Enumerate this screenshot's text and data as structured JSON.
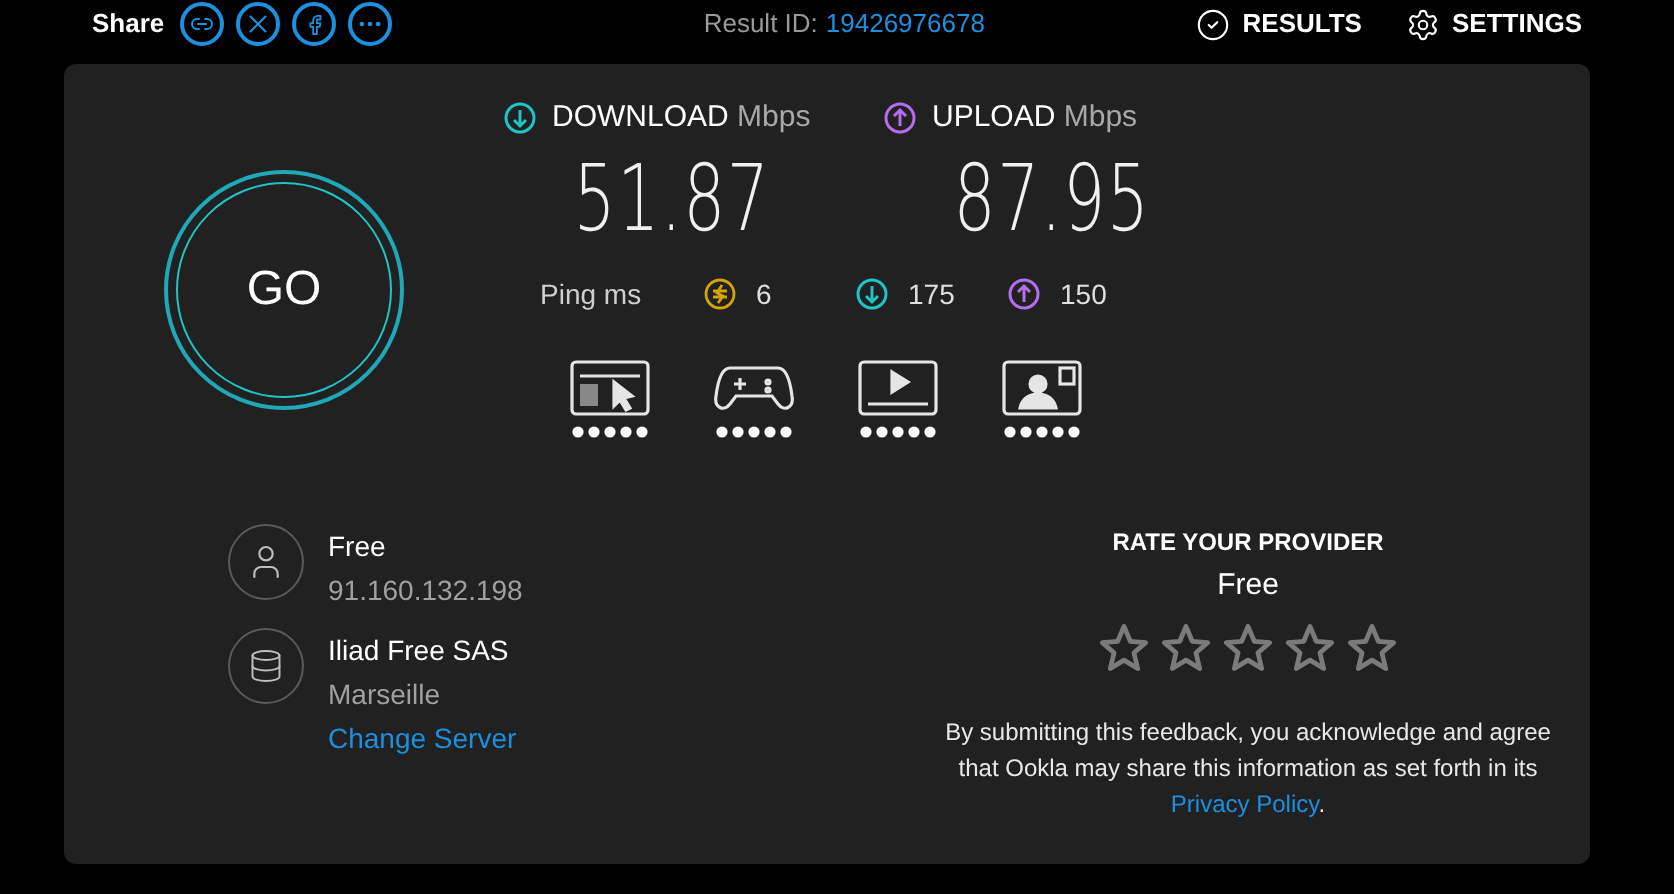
{
  "header": {
    "share_label": "Share",
    "result_label": "Result ID:",
    "result_id": "19426976678",
    "nav": [
      {
        "kind": "results",
        "label": "RESULTS"
      },
      {
        "kind": "settings",
        "label": "SETTINGS"
      }
    ]
  },
  "go_button": "GO",
  "metrics": [
    {
      "kind": "download",
      "label": "DOWNLOAD",
      "unit": "Mbps",
      "value": "51.87"
    },
    {
      "kind": "upload",
      "label": "UPLOAD",
      "unit": "Mbps",
      "value": "87.95"
    }
  ],
  "ping": {
    "label": "Ping ms",
    "readings": [
      {
        "kind": "idle",
        "value": "6"
      },
      {
        "kind": "download",
        "value": "175"
      },
      {
        "kind": "upload",
        "value": "150"
      }
    ]
  },
  "activities": [
    {
      "kind": "browsing"
    },
    {
      "kind": "gaming"
    },
    {
      "kind": "video"
    },
    {
      "kind": "call"
    }
  ],
  "connections": [
    {
      "kind": "client",
      "name": "Free",
      "detail": "91.160.132.198"
    },
    {
      "kind": "server",
      "name": "Iliad Free SAS",
      "detail": "Marseille",
      "link": "Change Server"
    }
  ],
  "rating": {
    "title": "RATE YOUR PROVIDER",
    "provider": "Free",
    "stars": 0,
    "note_before": "By submitting this feedback, you acknowledge and agree that Ookla may share this information as set forth in its",
    "link": "Privacy Policy",
    "note_after": "."
  }
}
